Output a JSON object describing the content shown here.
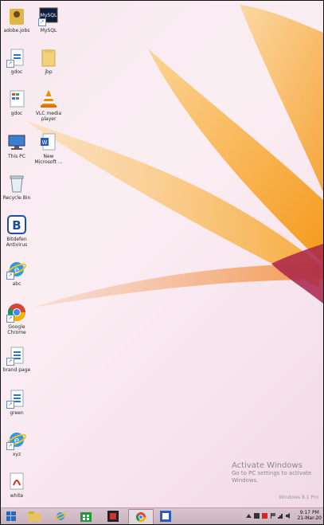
{
  "desktop": {
    "icons": [
      {
        "name": "adobe-folder-icon",
        "label": "adobe.jobs"
      },
      {
        "name": "mysql-icon",
        "label": "MySQL"
      },
      {
        "name": "document-icon",
        "label": "gdoc"
      },
      {
        "name": "folder-icon",
        "label": "jbp"
      },
      {
        "name": "spreadsheet-icon",
        "label": "gdoc"
      },
      {
        "name": "vlc-icon",
        "label": "VLC media player"
      },
      {
        "name": "this-pc-icon",
        "label": "This PC"
      },
      {
        "name": "word-icon",
        "label": "New Microsoft ..."
      },
      {
        "name": "recycle-bin-icon",
        "label": "Recycle Bin"
      },
      {
        "name": "bitdefender-icon",
        "label": "Bitdefen Antivirus"
      },
      {
        "name": "ie-icon",
        "label": "abc"
      },
      {
        "name": "chrome-icon",
        "label": "Google Chrome"
      },
      {
        "name": "document-icon",
        "label": "brand page"
      },
      {
        "name": "document-icon",
        "label": "green"
      },
      {
        "name": "ie-icon",
        "label": "xyz"
      },
      {
        "name": "pdf-icon",
        "label": "white"
      }
    ]
  },
  "watermark": {
    "title": "Activate Windows",
    "subtitle": "Go to PC settings to activate Windows.",
    "version": "Windows 8.1 Pro"
  },
  "taskbar": {
    "clock_time": "9:17 PM",
    "clock_date": "21-Mar-20"
  }
}
